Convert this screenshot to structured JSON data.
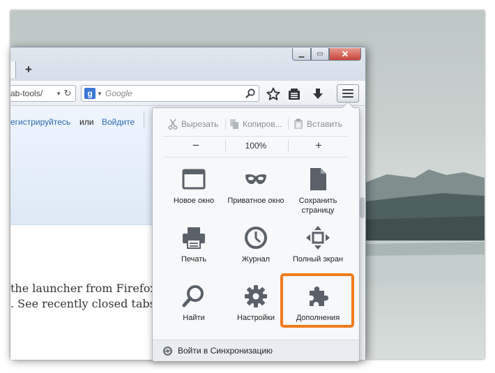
{
  "browser": {
    "url_fragment": "ab-tools/",
    "search_placeholder": "Google",
    "new_tab_label": "+"
  },
  "page": {
    "register_link": "егистрируйтесь",
    "or_text": "или",
    "login_link": "Войдите",
    "body_line_1": "the launcher from Firefox sta",
    "body_line_2": ". See recently closed tabs. And"
  },
  "menu": {
    "edit": {
      "cut": "Вырезать",
      "copy": "Копиров...",
      "paste": "Вставить"
    },
    "zoom": {
      "out": "−",
      "level": "100%",
      "in": "+"
    },
    "items": {
      "new_window": "Новое окно",
      "private_window": "Приватное окно",
      "save_page": "Сохранить страницу",
      "print": "Печать",
      "history": "Журнал",
      "fullscreen": "Полный экран",
      "find": "Найти",
      "settings": "Настройки",
      "addons": "Дополнения"
    },
    "sync_label": "Войти в Синхронизацию"
  },
  "colors": {
    "highlight": "#f07b1c",
    "link": "#2c6cb4",
    "icon": "#5b6168"
  },
  "icons": [
    "reload-icon",
    "google-icon",
    "search-go-icon",
    "bookmark-star-icon",
    "bookmarks-list-icon",
    "downloads-icon",
    "hamburger-menu-icon",
    "scissors-icon",
    "copy-icon",
    "paste-icon",
    "window-icon",
    "mask-icon",
    "page-icon",
    "printer-icon",
    "clock-icon",
    "fullscreen-arrows-icon",
    "magnifier-icon",
    "gear-icon",
    "puzzle-icon",
    "sync-icon"
  ]
}
